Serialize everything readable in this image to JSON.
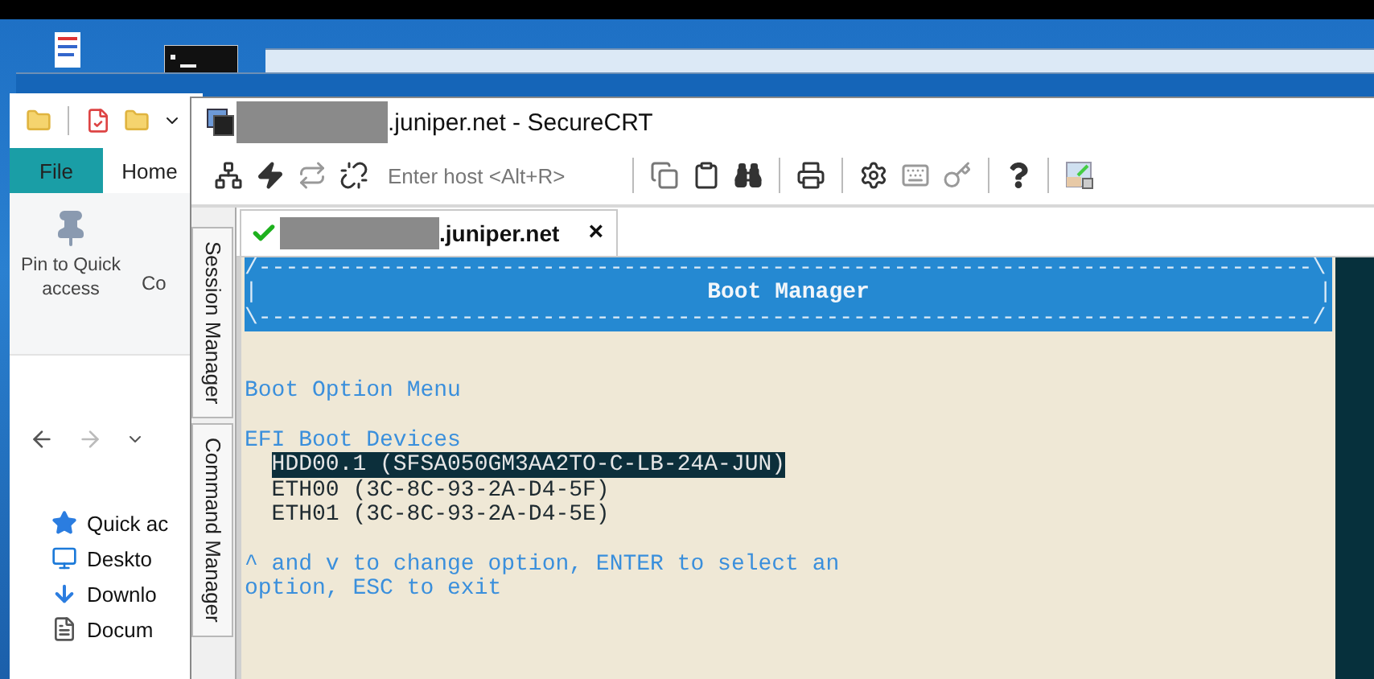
{
  "explorer": {
    "tabs": [
      {
        "label": "File",
        "selected": true
      },
      {
        "label": "Home",
        "selected": false
      }
    ],
    "ribbon": {
      "pin_label": "Pin to Quick access",
      "cut_label": "Co"
    },
    "nav_tree": [
      {
        "kind": "star",
        "label": "Quick ac"
      },
      {
        "kind": "desktop",
        "label": "Deskto"
      },
      {
        "kind": "download",
        "label": "Downlo"
      },
      {
        "kind": "document",
        "label": "Docum"
      }
    ]
  },
  "securecrt": {
    "title": {
      "redacted": true,
      "text": ".juniper.net - SecureCRT"
    },
    "toolbar": {
      "host_placeholder": "Enter host <Alt+R>"
    },
    "session_tabs": [
      {
        "redacted": true,
        "label": ".juniper.net",
        "connected": true,
        "selected": true,
        "close_label": "×"
      }
    ],
    "side_tabs": [
      "Session Manager",
      "Command Manager"
    ],
    "terminal": {
      "header": {
        "top_border": "/------------------------------------------------------------------------------\\",
        "left_edge": "|",
        "title": "Boot Manager",
        "right_edge": "|",
        "bottom_border": "\\------------------------------------------------------------------------------/"
      },
      "lines": [
        {
          "kind": "blank"
        },
        {
          "kind": "blank"
        },
        {
          "kind": "heading",
          "text": "Boot Option Menu"
        },
        {
          "kind": "blank"
        },
        {
          "kind": "heading",
          "text": "EFI Boot Devices"
        },
        {
          "kind": "option",
          "text": "HDD00.1 (SFSA050GM3AA2TO-C-LB-24A-JUN)",
          "selected": true
        },
        {
          "kind": "option",
          "text": "ETH00 (3C-8C-93-2A-D4-5F)",
          "selected": false
        },
        {
          "kind": "option",
          "text": "ETH01 (3C-8C-93-2A-D4-5E)",
          "selected": false
        },
        {
          "kind": "blank"
        },
        {
          "kind": "heading",
          "text": "^ and v to change option, ENTER to select an"
        },
        {
          "kind": "heading",
          "text": "option, ESC to exit"
        }
      ]
    }
  }
}
